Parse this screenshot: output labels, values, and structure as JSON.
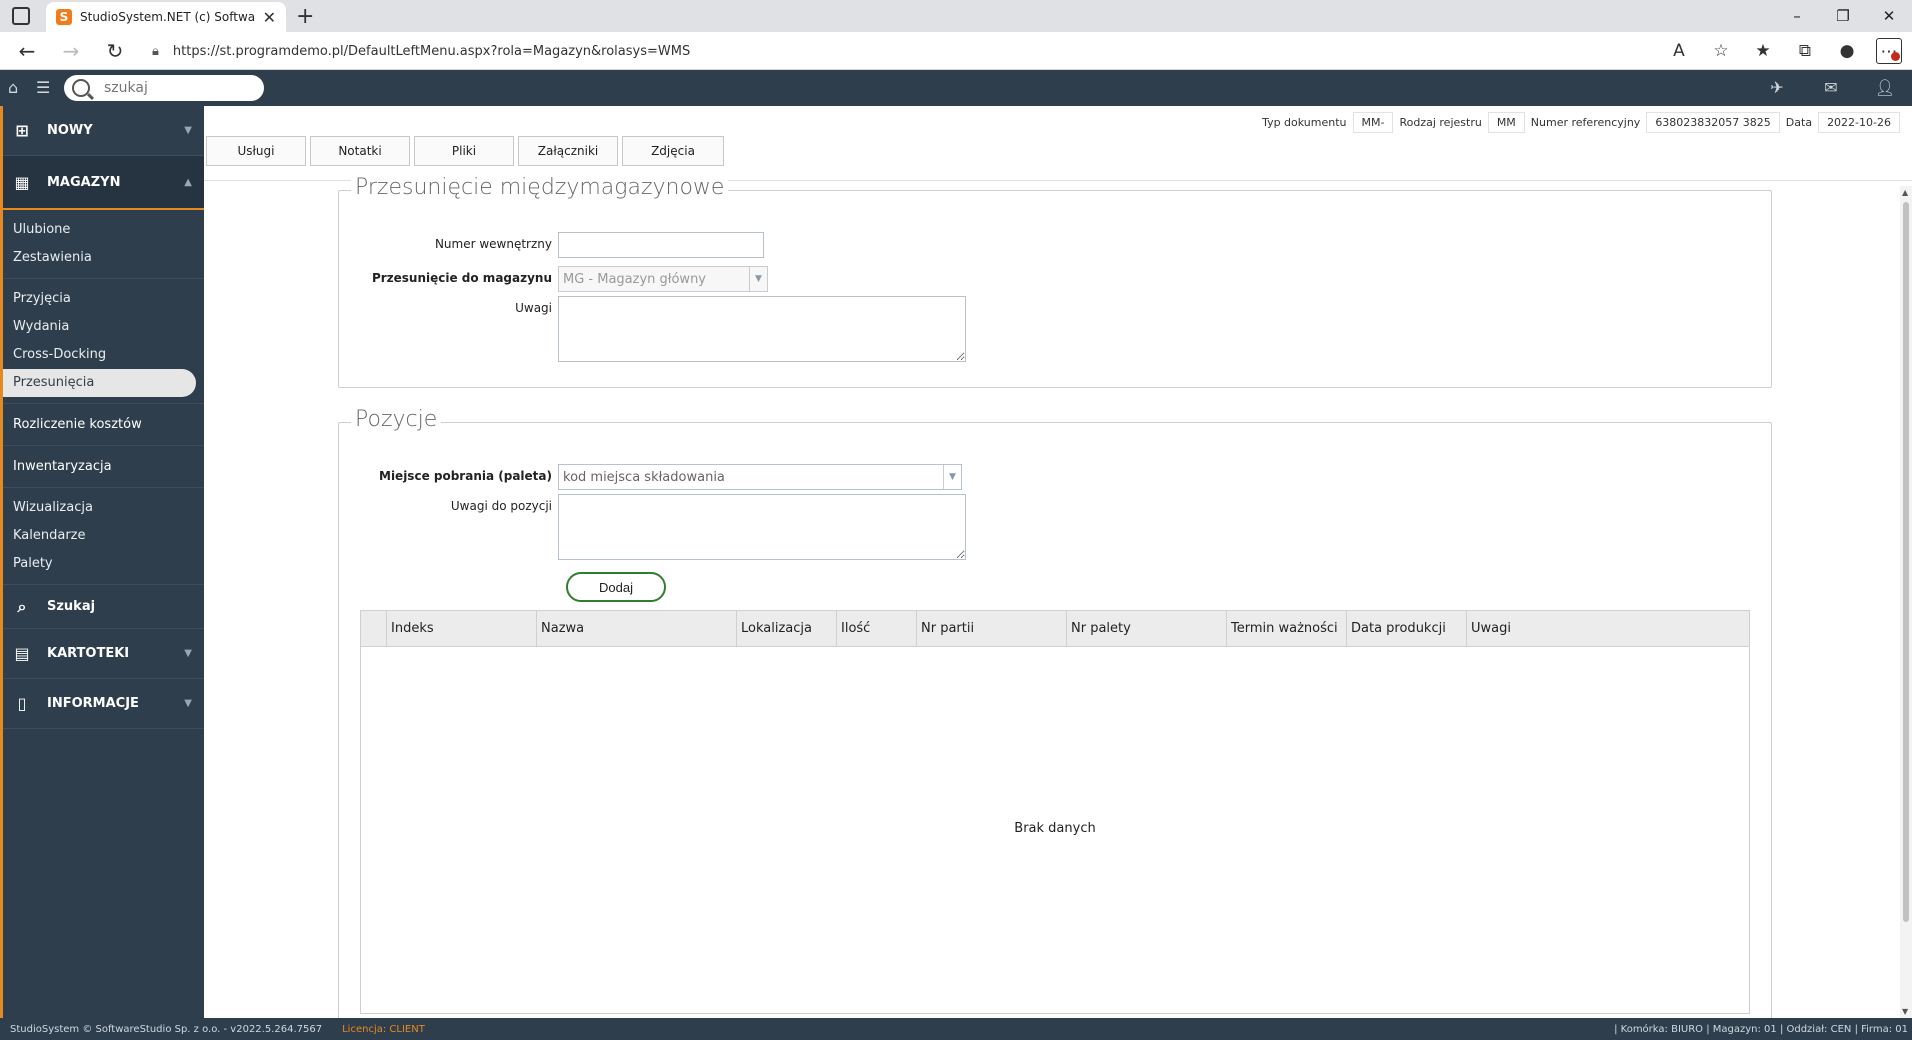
{
  "browser": {
    "tab_title": "StudioSystem.NET (c) SoftwareSt",
    "tab_favicon": "S",
    "url": "https://st.programdemo.pl/DefaultLeftMenu.aspx?rola=Magazyn&rolasys=WMS"
  },
  "app": {
    "search_placeholder": "szukaj"
  },
  "sidebar": {
    "nowy": "NOWY",
    "magazyn": "MAGAZYN",
    "group1": [
      "Ulubione",
      "Zestawienia"
    ],
    "group2": [
      "Przyjęcia",
      "Wydania",
      "Cross-Docking",
      "Przesunięcia"
    ],
    "rozliczenie": "Rozliczenie kosztów",
    "inwentaryzacja": "Inwentaryzacja",
    "group3": [
      "Wizualizacja",
      "Kalendarze",
      "Palety"
    ],
    "szukaj": "Szukaj",
    "kartoteki": "KARTOTEKI",
    "informacje": "INFORMACJE"
  },
  "doc_info": {
    "typ_label": "Typ dokumentu",
    "typ_value": "MM-",
    "rodzaj_label": "Rodzaj rejestru",
    "rodzaj_value": "MM",
    "numer_label": "Numer referencyjny",
    "numer_value": "638023832057 3825",
    "data_label": "Data",
    "data_value": "2022-10-26"
  },
  "tabs": [
    "Usługi",
    "Notatki",
    "Pliki",
    "Załączniki",
    "Zdjęcia"
  ],
  "section1": {
    "legend": "Przesunięcie międzymagazynowe",
    "numer_label": "Numer wewnętrzny",
    "numer_value": "",
    "magazyn_label": "Przesunięcie do magazynu",
    "magazyn_value": "MG - Magazyn główny",
    "uwagi_label": "Uwagi"
  },
  "section2": {
    "legend": "Pozycje",
    "miejsce_label": "Miejsce pobrania (paleta)",
    "miejsce_placeholder": "kod miejsca składowania",
    "uwagi_label": "Uwagi do pozycji",
    "add_label": "Dodaj"
  },
  "grid": {
    "columns": [
      "Indeks",
      "Nazwa",
      "Lokalizacja",
      "Ilość",
      "Nr partii",
      "Nr palety",
      "Termin ważności",
      "Data produkcji",
      "Uwagi"
    ],
    "empty": "Brak danych"
  },
  "footer": {
    "copyright": "StudioSystem © SoftwareStudio Sp. z o.o. - v2022.5.264.7567",
    "license": "Licencja: CLIENT",
    "status": "| Komórka: BIURO | Magazyn: 01 | Oddział: CEN | Firma: 01"
  },
  "colors": {
    "sidebar_bg": "#2f3e4c",
    "accent": "#e8891d",
    "add_button_border": "#2e7d32"
  }
}
